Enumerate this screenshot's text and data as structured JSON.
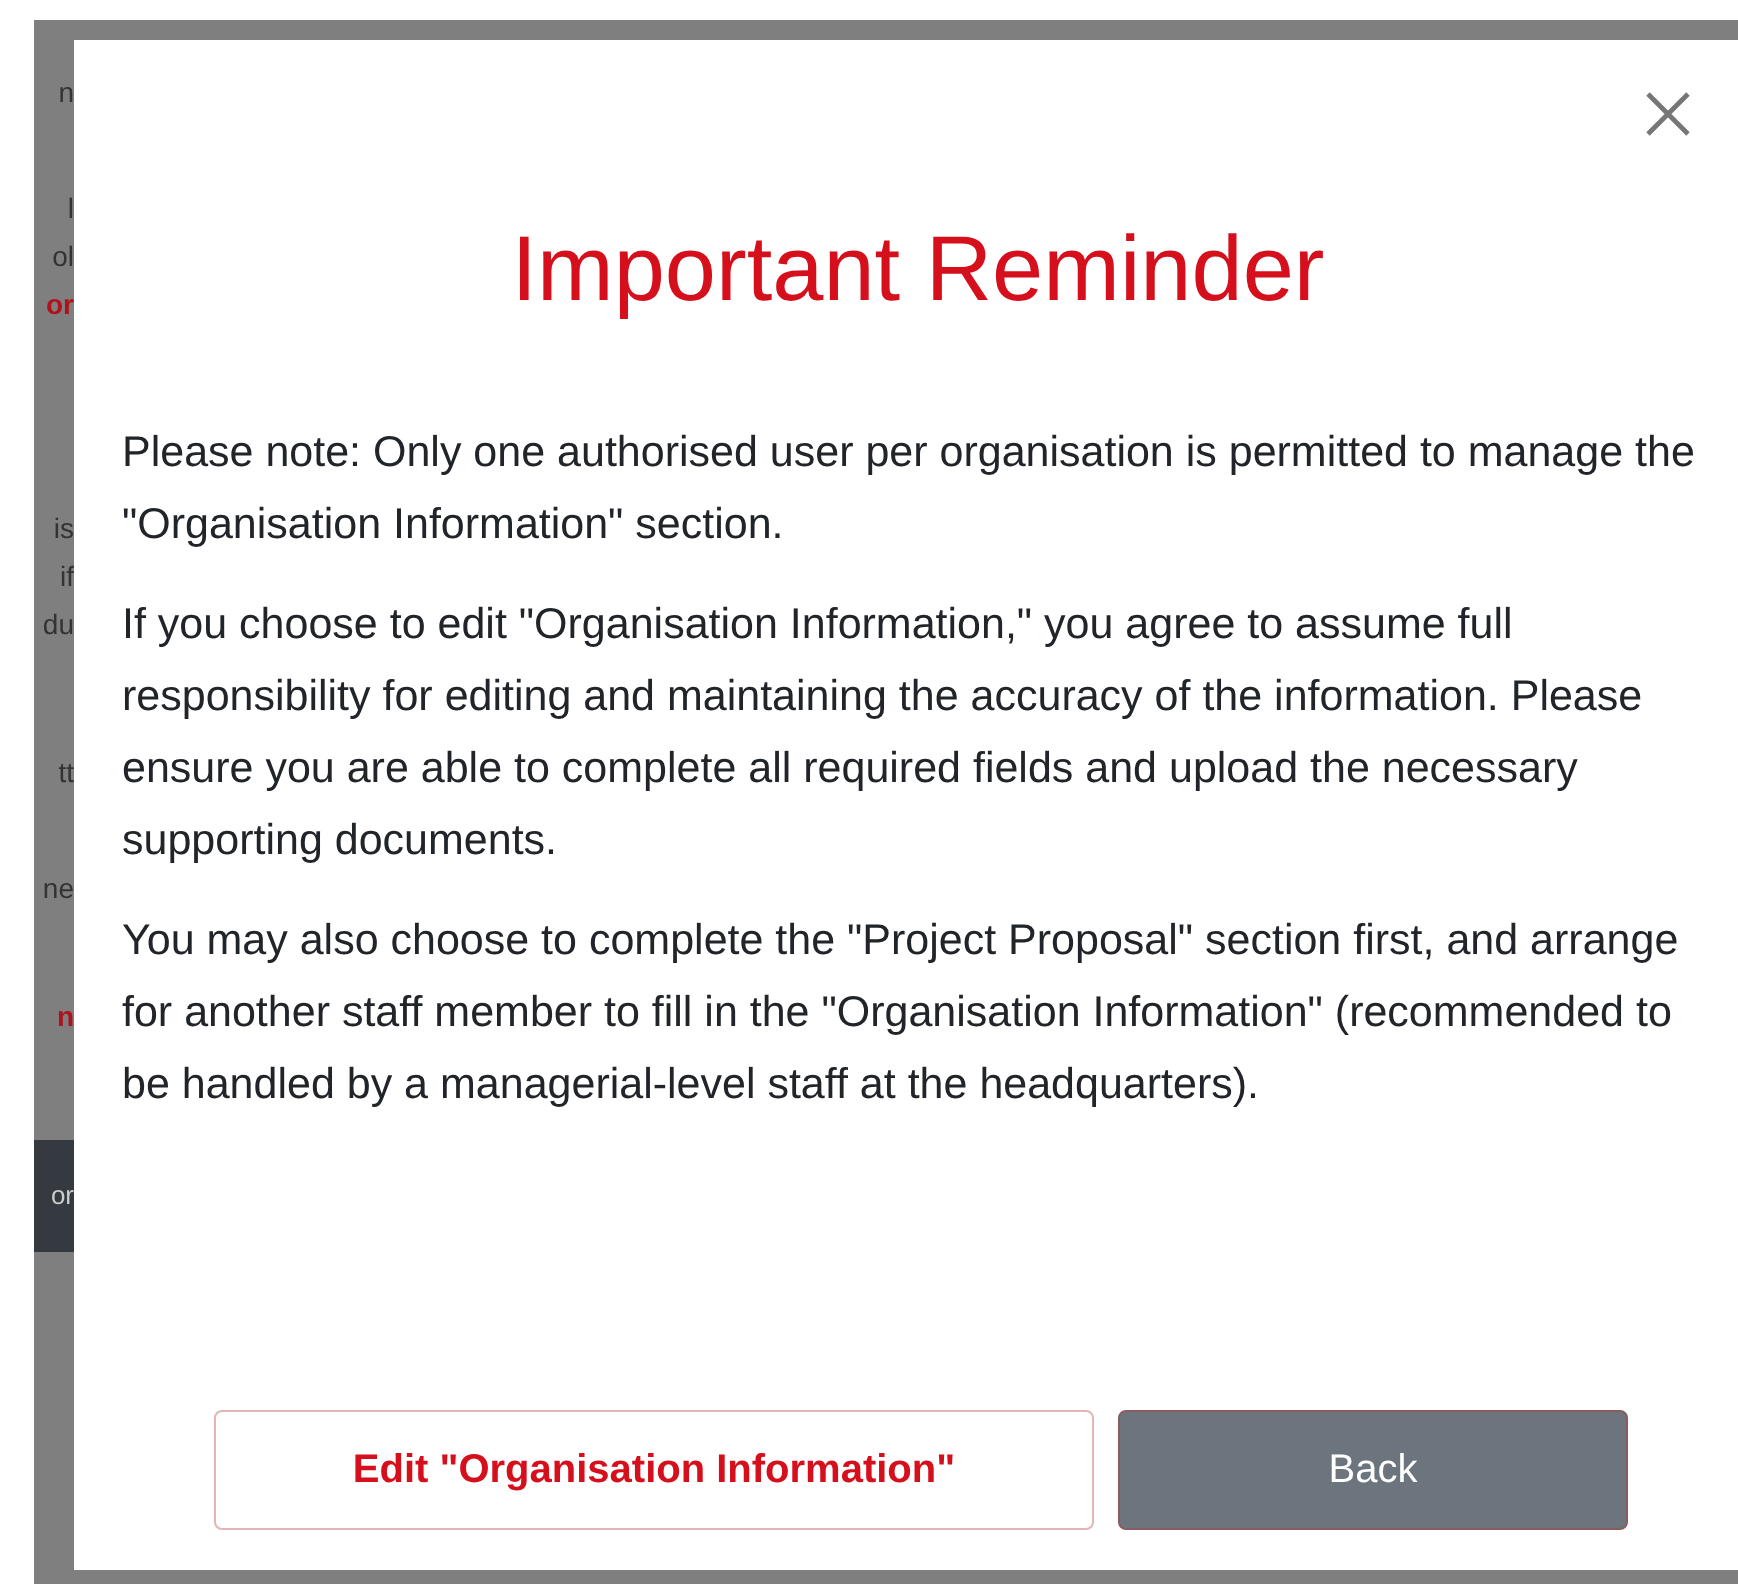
{
  "background_fragments": [
    {
      "text": "n",
      "kind": "text"
    },
    {
      "text": "l",
      "kind": "text"
    },
    {
      "text": "ol",
      "kind": "text"
    },
    {
      "text": "or",
      "kind": "link"
    },
    {
      "text": "is",
      "kind": "text"
    },
    {
      "text": "if",
      "kind": "text"
    },
    {
      "text": "du",
      "kind": "text"
    },
    {
      "text": "tt",
      "kind": "text"
    },
    {
      "text": "ne",
      "kind": "text"
    },
    {
      "text": "n",
      "kind": "link"
    },
    {
      "text": "or",
      "kind": "button"
    }
  ],
  "dialog": {
    "title": "Important Reminder",
    "paragraphs": [
      "Please note: Only one authorised user per organisation is permitted to manage the \"Organisation Information\" section.",
      "If you choose to edit \"Organisation Information,\" you agree to assume full responsibility for editing and maintaining the accuracy of the information. Please ensure you are able to complete all required fields and upload the necessary supporting documents.",
      "You may also choose to complete the \"Project Proposal\" section first, and arrange for another staff member to fill in the \"Organisation Information\" (recommended to be handled by a managerial-level staff at the headquarters)."
    ],
    "buttons": [
      {
        "label": "Edit \"Organisation Information\"",
        "kind": "outline"
      },
      {
        "label": "Back",
        "kind": "secondary"
      }
    ]
  }
}
